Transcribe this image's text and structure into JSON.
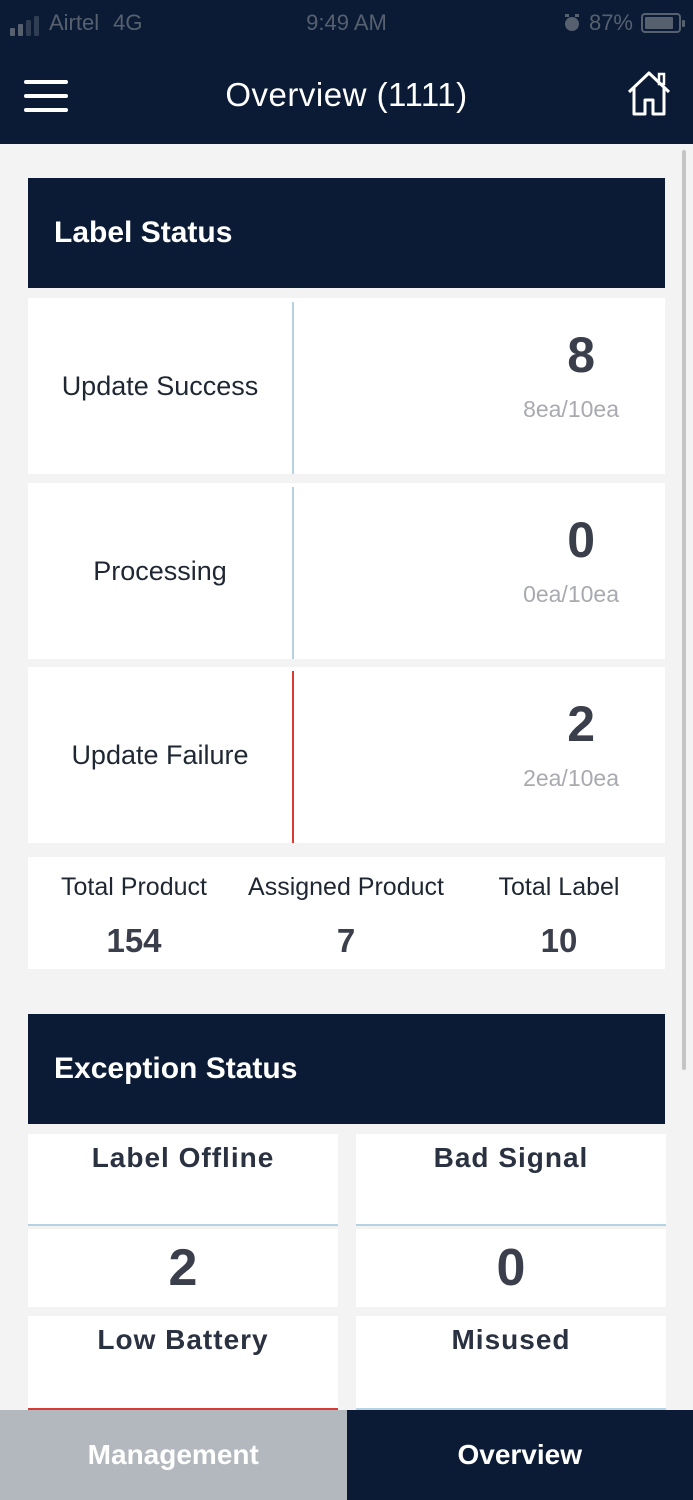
{
  "status_bar": {
    "carrier": "Airtel",
    "network": "4G",
    "time": "9:49 AM",
    "battery": "87%",
    "battery_level": 0.87
  },
  "header": {
    "title": "Overview (1111)",
    "menu_icon": "hamburger-menu-icon",
    "home_icon": "home-icon"
  },
  "label_status": {
    "title": "Label Status",
    "rows": [
      {
        "label": "Update Success",
        "value": "8",
        "sub": "8ea/10ea",
        "color": "#b5d3e3"
      },
      {
        "label": "Processing",
        "value": "0",
        "sub": "0ea/10ea",
        "color": "#b5d3e3"
      },
      {
        "label": "Update Failure",
        "value": "2",
        "sub": "2ea/10ea",
        "color": "#d93a32"
      }
    ],
    "totals": [
      {
        "label": "Total Product",
        "value": "154"
      },
      {
        "label": "Assigned Product",
        "value": "7"
      },
      {
        "label": "Total Label",
        "value": "10"
      }
    ]
  },
  "exception_status": {
    "title": "Exception Status",
    "cards": [
      {
        "label": "Label Offline",
        "value": "2",
        "color": "#b5d3e3"
      },
      {
        "label": "Bad Signal",
        "value": "0",
        "color": "#b5d3e3"
      },
      {
        "label": "Low Battery",
        "color": "#d93a32"
      },
      {
        "label": "Misused",
        "color": "#b5d3e3"
      }
    ]
  },
  "bottom_nav": {
    "management": "Management",
    "overview": "Overview",
    "active": "overview"
  },
  "colors": {
    "navy": "#0b1b35",
    "inactive_tab": "#b3b7be",
    "ok_line": "#b5d3e3",
    "fail_line": "#d93a32"
  }
}
